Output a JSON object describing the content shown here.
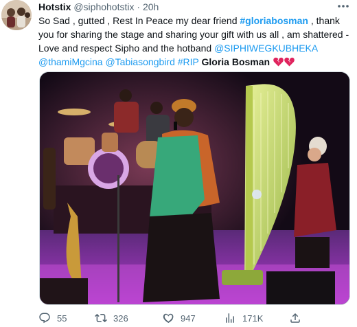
{
  "tweet": {
    "display_name": "Hotstix",
    "handle": "@siphohotstix",
    "separator": "·",
    "time": "20h",
    "text_parts": {
      "p1": "So Sad , gutted , Rest In Peace my dear friend ",
      "tag1": "#gloriabosman",
      "p2": " , thank you for sharing the stage and sharing your gift with us all , am shattered - Love and respect Sipho and the hotband ",
      "mention1": "@SIPHIWEGKUBHEKA",
      "mention2": "@thamiMgcina",
      "mention3": "@Tabiasongbird",
      "tag2": "#RIP",
      "name": "Gloria Bosman"
    },
    "emoji": [
      "broken-heart",
      "broken-heart"
    ]
  },
  "actions": {
    "replies": "55",
    "retweets": "326",
    "likes": "947",
    "views": "171K"
  },
  "icons": {
    "more": "more-icon",
    "reply": "reply-icon",
    "retweet": "retweet-icon",
    "like": "heart-icon",
    "views": "views-icon",
    "share": "share-icon"
  },
  "colors": {
    "link": "#1d9bf0",
    "text": "#0f1419",
    "secondary": "#536471",
    "broken_heart": "#e0245e"
  }
}
